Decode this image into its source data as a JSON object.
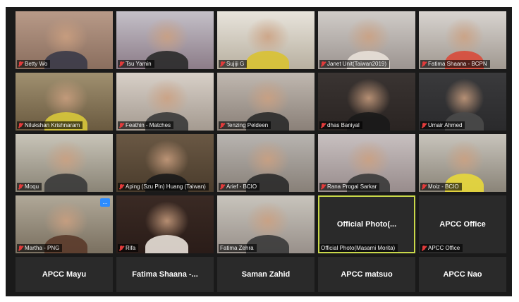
{
  "gallery": {
    "tiles": [
      {
        "name": "Betty Wo",
        "muted": true
      },
      {
        "name": "Tsu Yamin",
        "muted": true
      },
      {
        "name": "Sujiji G",
        "muted": true
      },
      {
        "name": "Janet Unit(Taiwan2019)",
        "muted": true
      },
      {
        "name": "Fatima Shaana - BCPN",
        "muted": true
      },
      {
        "name": "Nilukshan Krishnaram",
        "muted": true
      },
      {
        "name": "Feathin - Matches",
        "muted": true
      },
      {
        "name": "Tenzing Peldeen",
        "muted": true
      },
      {
        "name": "dhas Baniyal",
        "muted": true
      },
      {
        "name": "Umair Ahmed",
        "muted": true
      },
      {
        "name": "Moqu",
        "muted": true
      },
      {
        "name": "Aping (Szu Pin) Huang (Taiwan)",
        "muted": true
      },
      {
        "name": "Arief - BCIO",
        "muted": true
      },
      {
        "name": "Rana Progal Sarkar",
        "muted": true
      },
      {
        "name": "Moiz - BCIO",
        "muted": true
      },
      {
        "name": "Martha - PNG",
        "muted": true
      },
      {
        "name": "Rifa",
        "muted": true
      },
      {
        "name": "Fatima Zehra",
        "muted": false
      },
      {
        "name": "Official Photo(Masami Morita)",
        "center_label": "Official Photo(...",
        "muted": false
      },
      {
        "name": "APCC Office",
        "center_label": "APCC Office",
        "muted": true
      },
      {
        "center_label": "APCC Mayu"
      },
      {
        "center_label": "Fatima Shaana -..."
      },
      {
        "center_label": "Saman Zahid"
      },
      {
        "center_label": "APCC matsuo"
      },
      {
        "center_label": "APCC Nao"
      }
    ],
    "more_button": "…"
  },
  "colors": {
    "active_border": "#c9d84a",
    "mute_icon": "#e23b3b",
    "more_button": "#2d8cff"
  }
}
